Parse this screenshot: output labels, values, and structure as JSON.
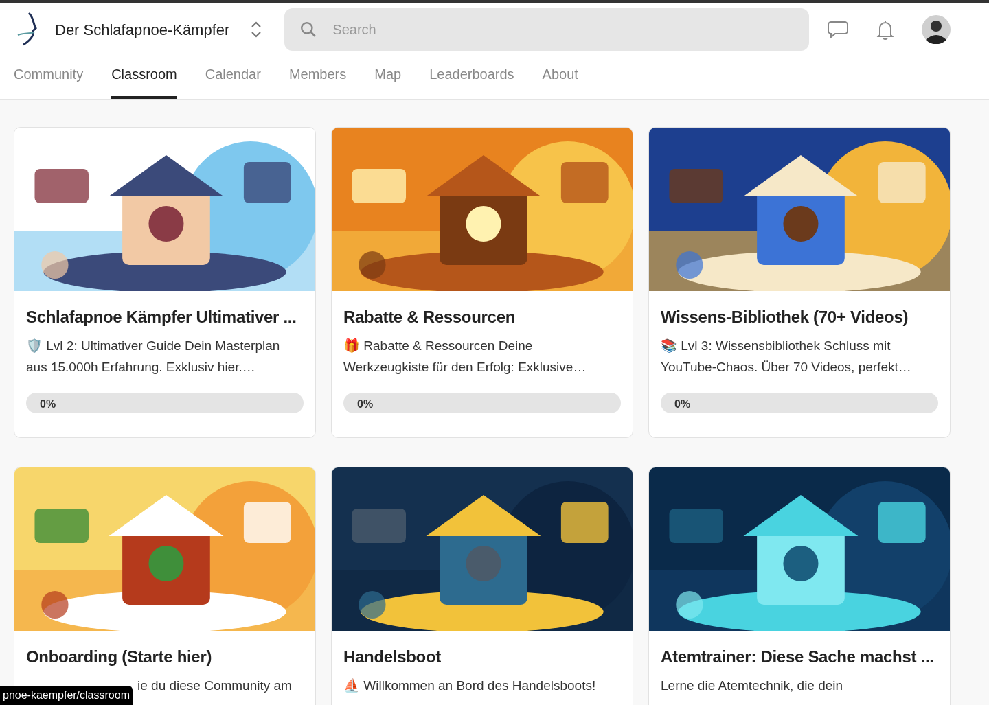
{
  "header": {
    "community_name": "Der Schlafapnoe-Kämpfer",
    "search": {
      "placeholder": "Search"
    }
  },
  "tabs": [
    {
      "label": "Community",
      "selected": false
    },
    {
      "label": "Classroom",
      "selected": true
    },
    {
      "label": "Calendar",
      "selected": false
    },
    {
      "label": "Members",
      "selected": false
    },
    {
      "label": "Map",
      "selected": false
    },
    {
      "label": "Leaderboards",
      "selected": false
    },
    {
      "label": "About",
      "selected": false
    }
  ],
  "courses": [
    {
      "title": "Schlafapnoe Kämpfer Ultimativer ...",
      "description": "🛡️ Lvl 2: Ultimativer Guide Dein Masterplan aus 15.000h Erfahrung. Exklusiv hier.…",
      "progress": {
        "level": 0,
        "reading": "0%"
      }
    },
    {
      "title": "Rabatte & Ressourcen",
      "description": "🎁 Rabatte & Ressourcen Deine Werkzeugkiste für den Erfolg: Exklusive…",
      "progress": {
        "level": 0,
        "reading": "0%"
      }
    },
    {
      "title": "Wissens-Bibliothek (70+ Videos)",
      "description": "📚 Lvl 3: Wissensbibliothek Schluss mit YouTube-Chaos. Über 70 Videos, perfekt…",
      "progress": {
        "level": 0,
        "reading": "0%"
      }
    },
    {
      "title": "Onboarding (Starte hier)",
      "description": "ie du diese Community am"
    },
    {
      "title": "Handelsboot",
      "description": "⛵ Willkommen an Bord des Handelsboots!"
    },
    {
      "title": "Atemtrainer: Diese Sache machst ...",
      "description": "Lerne die Atemtechnik, die dein"
    }
  ],
  "status_bar": {
    "url": "pnoe-kaempfer/classroom"
  }
}
